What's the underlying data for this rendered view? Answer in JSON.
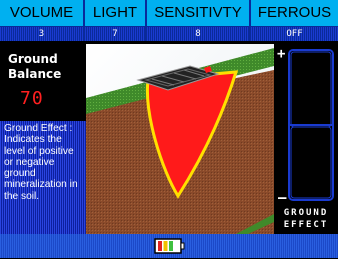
{
  "settings": [
    {
      "label": "VOLUME",
      "value": "3"
    },
    {
      "label": "LIGHT",
      "value": "7"
    },
    {
      "label": "SENSITIVTY",
      "value": "8"
    },
    {
      "label": "FERROUS",
      "value": "OFF"
    }
  ],
  "ground_balance": {
    "title_line1": "Ground",
    "title_line2": "Balance",
    "value": "70"
  },
  "info_text": "Ground Effect : Indicates the level of positive or negative ground mineralization in the soil.",
  "meter": {
    "plus": "+",
    "minus": "–",
    "label_line1": "GROUND",
    "label_line2": "EFFECT",
    "level": 0.5
  },
  "battery": {
    "icon": "battery-icon",
    "level": 0.75
  },
  "colors": {
    "tab_label_bg": "#00b0f0",
    "tab_value_bg": "#0a2a9a",
    "gb_value": "#ff2020",
    "soil": "#8a4a2a",
    "grass": "#3f8a2a",
    "detection_field": "#ff1a1a",
    "detection_outline": "#ffe000"
  }
}
